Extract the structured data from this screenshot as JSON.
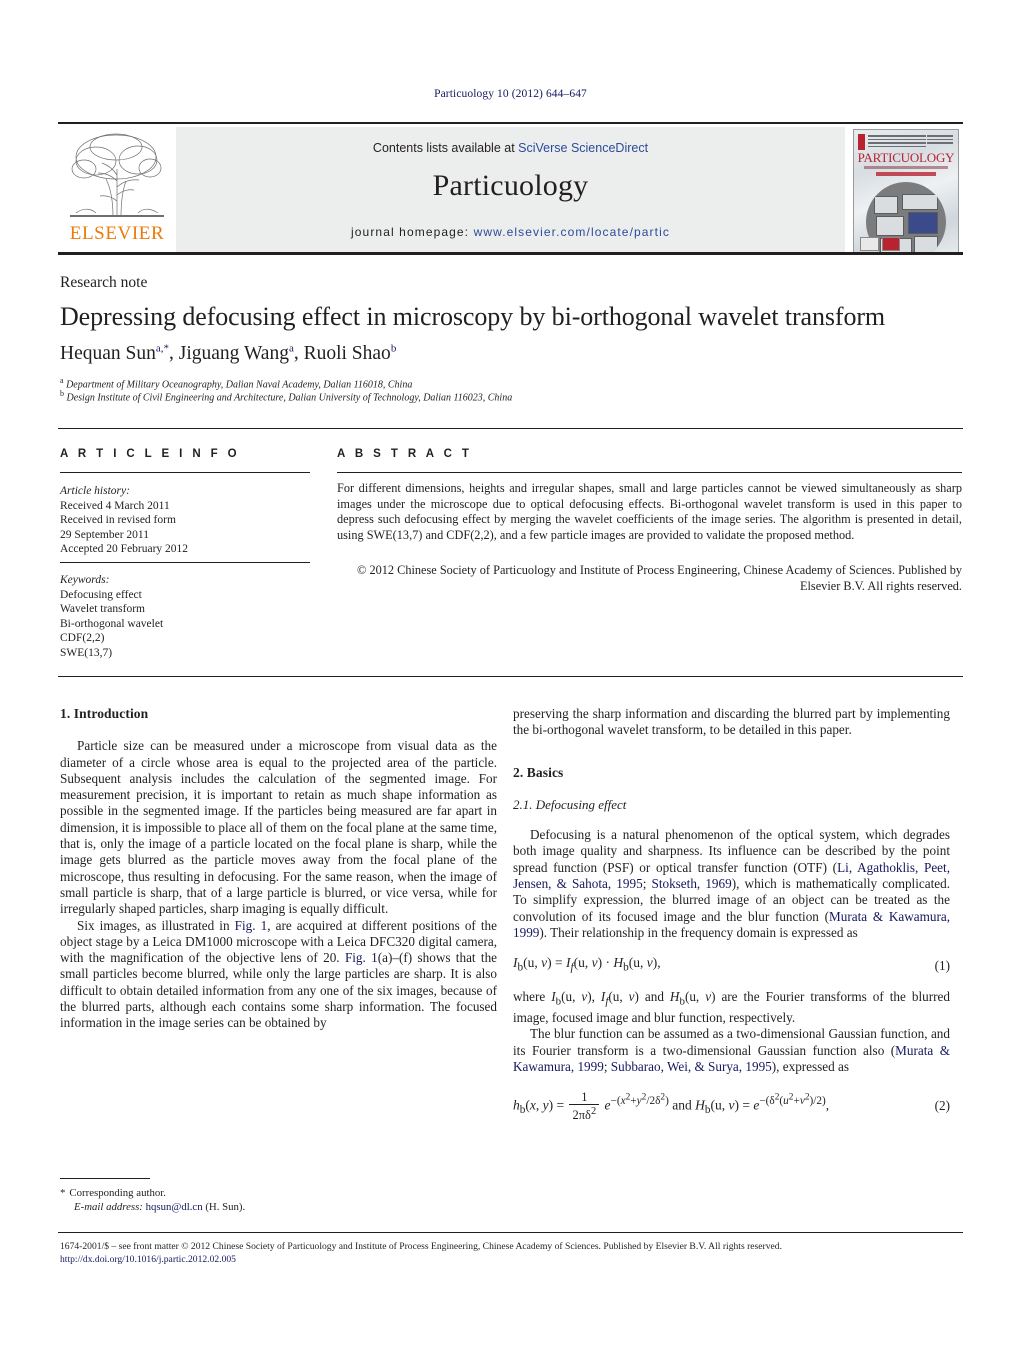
{
  "running_head": "Particuology 10 (2012) 644–647",
  "masthead": {
    "publisher_logo_text": "ELSEVIER",
    "contents_prefix": "Contents lists available at ",
    "contents_link": "SciVerse ScienceDirect",
    "journal_name": "Particuology",
    "homepage_prefix": "journal homepage: ",
    "homepage_url": "www.elsevier.com/locate/partic",
    "cover_title": "PARTICUOLOGY",
    "accent_color": "#2b4b9b",
    "elsevier_orange": "#ec7a08",
    "cover_red": "#b8232f"
  },
  "article": {
    "type": "Research note",
    "title": "Depressing defocusing effect in microscopy by bi-orthogonal wavelet transform",
    "authors": [
      {
        "name": "Hequan Sun",
        "marks": "a,*"
      },
      {
        "name": "Jiguang Wang",
        "marks": "a"
      },
      {
        "name": "Ruoli Shao",
        "marks": "b"
      }
    ],
    "affiliations": [
      {
        "mark": "a",
        "text": "Department of Military Oceanography, Dalian Naval Academy, Dalian 116018, China"
      },
      {
        "mark": "b",
        "text": "Design Institute of Civil Engineering and Architecture, Dalian University of Technology, Dalian 116023, China"
      }
    ]
  },
  "info": {
    "heading": "A R T I C L E  I N F O",
    "history_label": "Article history:",
    "history": [
      "Received 4 March 2011",
      "Received in revised form",
      "29 September 2011",
      "Accepted 20 February 2012"
    ],
    "keywords_label": "Keywords:",
    "keywords": [
      "Defocusing effect",
      "Wavelet transform",
      "Bi-orthogonal wavelet",
      "CDF(2,2)",
      "SWE(13,7)"
    ]
  },
  "abstract": {
    "heading": "A B S T R A C T",
    "text": "For different dimensions, heights and irregular shapes, small and large particles cannot be viewed simultaneously as sharp images under the microscope due to optical defocusing effects. Bi-orthogonal wavelet transform is used in this paper to depress such defocusing effect by merging the wavelet coefficients of the image series. The algorithm is presented in detail, using SWE(13,7) and CDF(2,2), and a few particle images are provided to validate the proposed method.",
    "copyright": "© 2012 Chinese Society of Particuology and Institute of Process Engineering, Chinese Academy of Sciences. Published by Elsevier B.V. All rights reserved."
  },
  "body": {
    "intro_heading": "1.  Introduction",
    "intro_p1": "Particle size can be measured under a microscope from visual data as the diameter of a circle whose area is equal to the projected area of the particle. Subsequent analysis includes the calculation of the segmented image. For measurement precision, it is important to retain as much shape information as possible in the segmented image. If the particles being measured are far apart in dimension, it is impossible to place all of them on the focal plane at the same time, that is, only the image of a particle located on the focal plane is sharp, while the image gets blurred as the particle moves away from the focal plane of the microscope, thus resulting in defocusing. For the same reason, when the image of small particle is sharp, that of a large particle is blurred, or vice versa, while for irregularly shaped particles, sharp imaging is equally difficult.",
    "intro_p2_a": "Six images, as illustrated in ",
    "intro_p2_fig1": "Fig. 1",
    "intro_p2_b": ", are acquired at different positions of the object stage by a Leica DM1000 microscope with a Leica DFC320 digital camera, with the magnification of the objective lens of 20. ",
    "intro_p2_fig2": "Fig. 1",
    "intro_p2_c": "(a)–(f) shows that the small particles become blurred, while only the large particles are sharp. It is also difficult to obtain detailed information from any one of the six images, because of the blurred parts, although each contains some sharp information. The focused information in the image series can be obtained by",
    "right_p1": "preserving the sharp information and discarding the blurred part by implementing the bi-orthogonal wavelet transform, to be detailed in this paper.",
    "basics_heading": "2.  Basics",
    "defocus_heading": "2.1.  Defocusing effect",
    "defocus_p1_a": "Defocusing is a natural phenomenon of the optical system, which degrades both image quality and sharpness. Its influence can be described by the point spread function (PSF) or optical transfer function (OTF) (",
    "ref_li": "Li, Agathoklis, Peet, Jensen, & Sahota, 1995",
    "ref_stokseth": "Stokseth, 1969",
    "defocus_p1_b": "), which is mathematically complicated. To simplify expression, the blurred image of an object can be treated as the convolution of its focused image and the blur function (",
    "ref_murata": "Murata & Kawamura, 1999",
    "defocus_p1_c": "). Their relationship in the frequency domain is expressed as",
    "eq1_num": "(1)",
    "after_eq1": "are the Fourier transforms of the blurred image, focused image and blur function, respectively.",
    "defocus_p2_a": "The blur function can be assumed as a two-dimensional Gaussian function, and its Fourier transform is a two-dimensional Gaussian function also (",
    "ref_murata2": "Murata & Kawamura, 1999",
    "ref_subbarao": "Subbarao, Wei, & Surya, 1995",
    "defocus_p2_b": "), expressed as",
    "eq2_num": "(2)"
  },
  "footnote": {
    "corresponding": "Corresponding author.",
    "email_label": "E-mail address:",
    "email": "hqsun@dl.cn",
    "email_owner": "(H. Sun)."
  },
  "page_footer": {
    "line1": "1674-2001/$ – see front matter © 2012 Chinese Society of Particuology and Institute of Process Engineering, Chinese Academy of Sciences. Published by Elsevier B.V. All rights reserved.",
    "doi": "http://dx.doi.org/10.1016/j.partic.2012.02.005"
  }
}
